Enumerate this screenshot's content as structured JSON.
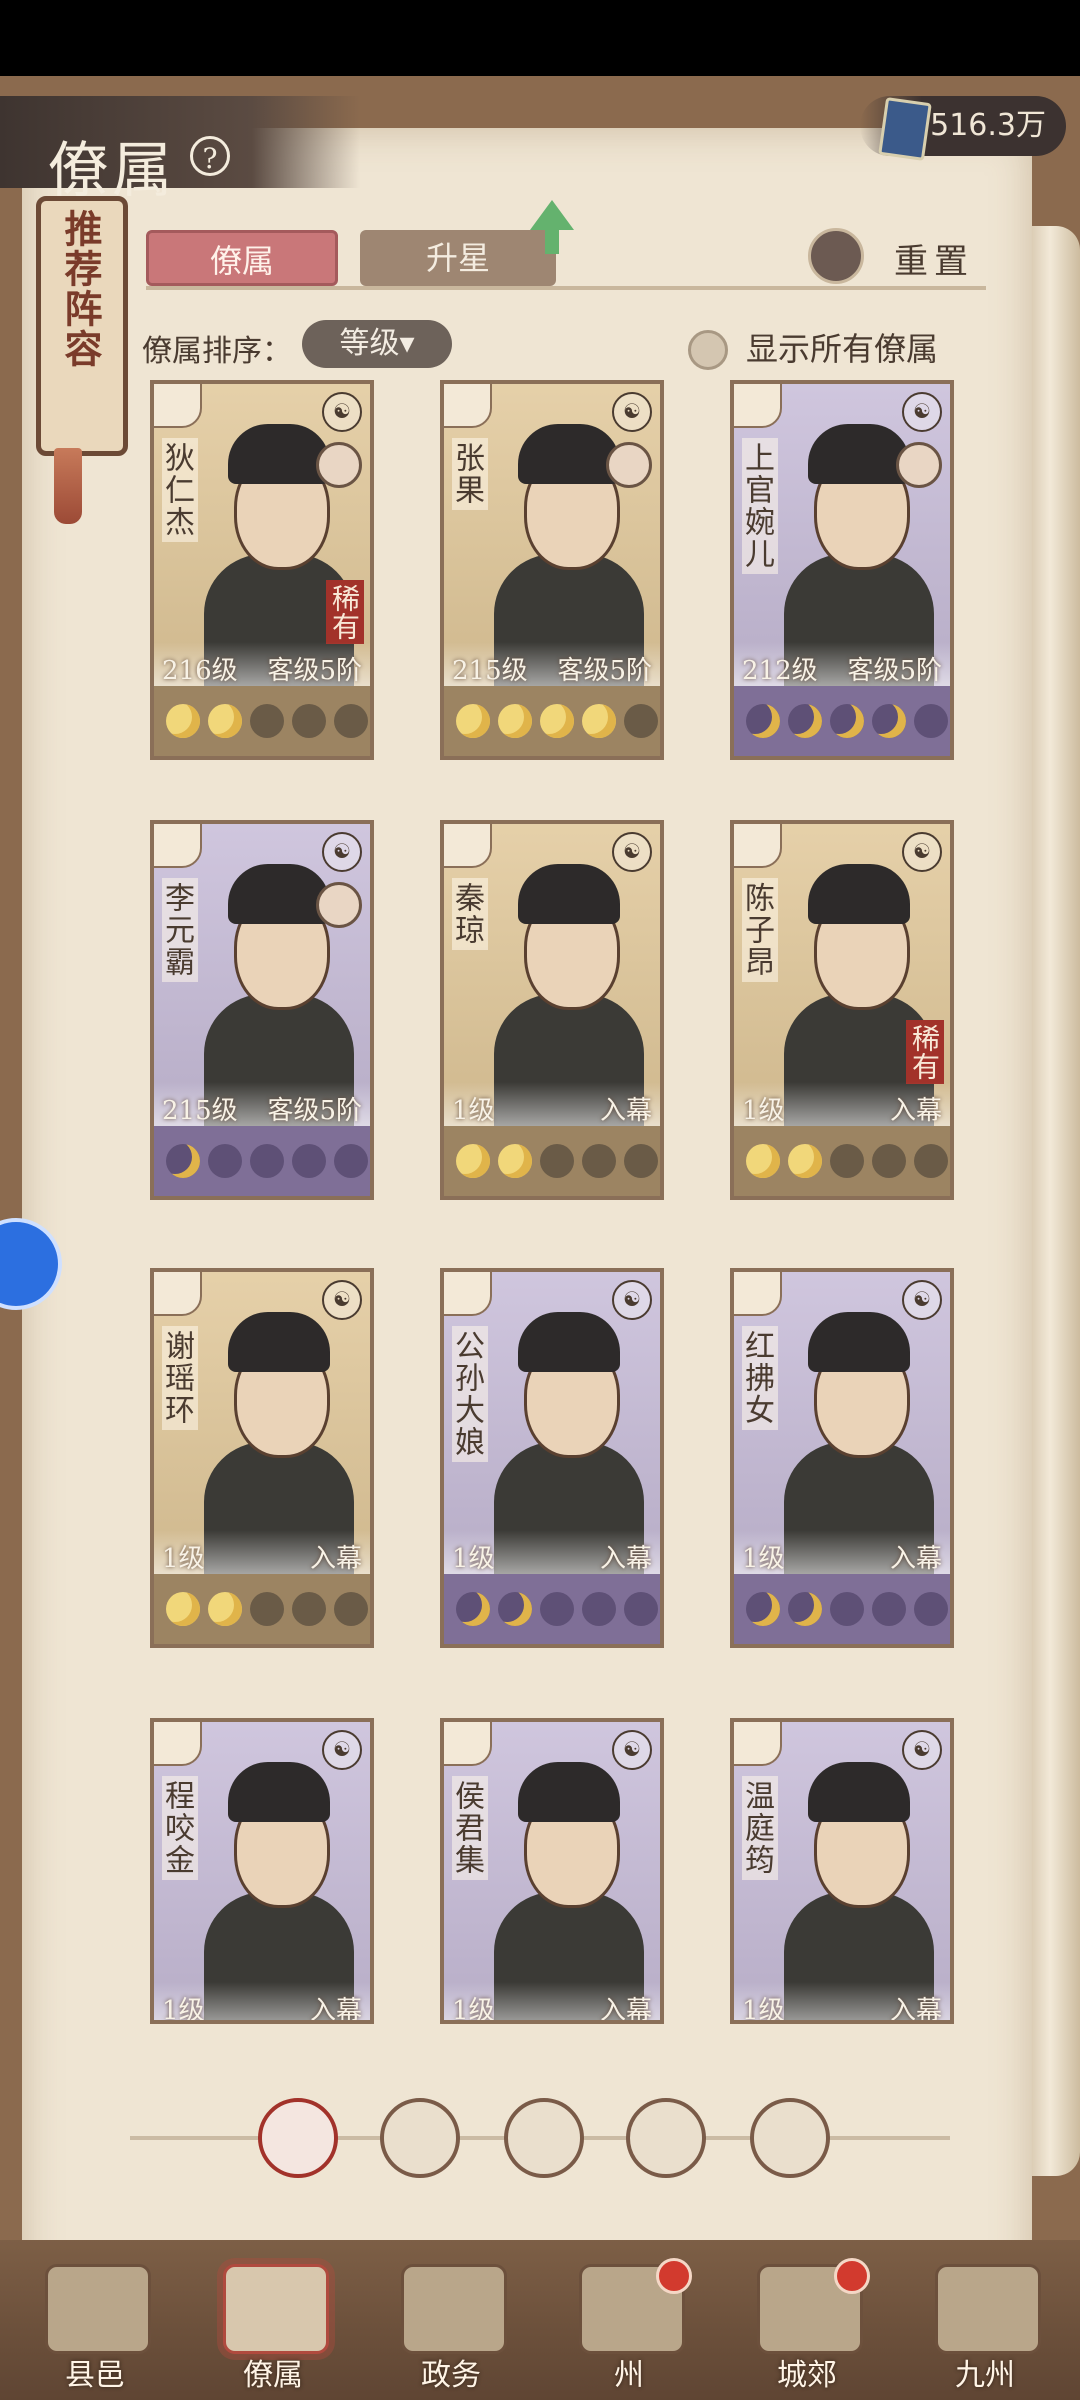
{
  "header": {
    "title": "僚属",
    "currency": "516.3万"
  },
  "recommend": {
    "label": "推荐阵容"
  },
  "tabs": [
    {
      "label": "僚属"
    },
    {
      "label": "升星"
    }
  ],
  "reset": {
    "label": "重置"
  },
  "sort": {
    "label": "僚属排序：",
    "value": "等级▾"
  },
  "show_all": {
    "label": "显示所有僚属"
  },
  "cards": [
    {
      "name": "狄仁杰",
      "level": "216级",
      "stage": "客级5阶",
      "rarity": "稀有",
      "stars_lit": 2,
      "stars": 5
    },
    {
      "name": "张果",
      "level": "215级",
      "stage": "客级5阶",
      "rarity": "",
      "stars_lit": 4,
      "stars": 5
    },
    {
      "name": "上官婉儿",
      "level": "212级",
      "stage": "客级5阶",
      "rarity": "",
      "stars_lit": 4,
      "stars": 5
    },
    {
      "name": "李元霸",
      "level": "215级",
      "stage": "客级5阶",
      "rarity": "",
      "stars_lit": 1,
      "stars": 5
    },
    {
      "name": "秦琼",
      "level": "1级",
      "stage": "入幕",
      "rarity": "",
      "stars_lit": 2,
      "stars": 5
    },
    {
      "name": "陈子昂",
      "level": "1级",
      "stage": "入幕",
      "rarity": "稀有",
      "stars_lit": 2,
      "stars": 5
    },
    {
      "name": "谢瑶环",
      "level": "1级",
      "stage": "入幕",
      "rarity": "",
      "stars_lit": 2,
      "stars": 5
    },
    {
      "name": "公孙大娘",
      "level": "1级",
      "stage": "入幕",
      "rarity": "",
      "stars_lit": 2,
      "stars": 5
    },
    {
      "name": "红拂女",
      "level": "1级",
      "stage": "入幕",
      "rarity": "",
      "stars_lit": 2,
      "stars": 5
    },
    {
      "name": "程咬金",
      "level": "1级",
      "stage": "入幕",
      "rarity": "",
      "stars_lit": 0,
      "stars": 0
    },
    {
      "name": "侯君集",
      "level": "1级",
      "stage": "入幕",
      "rarity": "",
      "stars_lit": 0,
      "stars": 0
    },
    {
      "name": "温庭筠",
      "level": "1级",
      "stage": "入幕",
      "rarity": "",
      "stars_lit": 0,
      "stars": 0
    }
  ],
  "factions": [
    "all-faction-icon",
    "bell-faction-icon",
    "gourd-faction-icon",
    "fan-faction-icon",
    "lion-faction-icon"
  ],
  "nav": [
    {
      "label": "县邑",
      "badge": false
    },
    {
      "label": "僚属",
      "badge": false
    },
    {
      "label": "政务",
      "badge": false
    },
    {
      "label": "州",
      "badge": true
    },
    {
      "label": "城郊",
      "badge": true
    },
    {
      "label": "九州",
      "badge": false
    }
  ],
  "colors": {
    "accent": "#c97779",
    "rarity": "#a2322a",
    "star": "#f1d77a"
  }
}
